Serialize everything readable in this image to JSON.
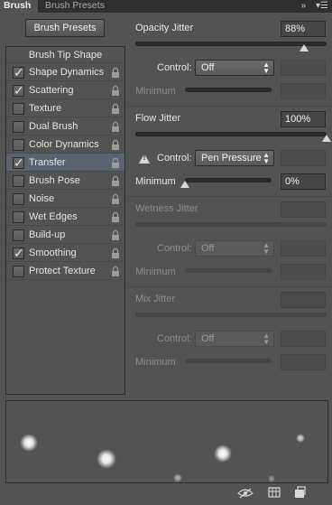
{
  "tabs": [
    {
      "label": "Brush"
    },
    {
      "label": "Brush Presets"
    }
  ],
  "tab_icons": {
    "collapse": "»",
    "menu": "▾☰"
  },
  "presets_button": "Brush Presets",
  "list": {
    "header": "Brush Tip Shape",
    "items": [
      {
        "label": "Shape Dynamics",
        "checked": true
      },
      {
        "label": "Scattering",
        "checked": true
      },
      {
        "label": "Texture",
        "checked": false
      },
      {
        "label": "Dual Brush",
        "checked": false
      },
      {
        "label": "Color Dynamics",
        "checked": false
      },
      {
        "label": "Transfer",
        "checked": true,
        "selected": true
      },
      {
        "label": "Brush Pose",
        "checked": false
      },
      {
        "label": "Noise",
        "checked": false
      },
      {
        "label": "Wet Edges",
        "checked": false
      },
      {
        "label": "Build-up",
        "checked": false
      },
      {
        "label": "Smoothing",
        "checked": true
      },
      {
        "label": "Protect Texture",
        "checked": false
      }
    ],
    "check_glyph": "✓"
  },
  "opacity": {
    "label": "Opacity Jitter",
    "value": "88%",
    "slider_fraction": 0.88,
    "control_label": "Control:",
    "control_value": "Off",
    "minimum_label": "Minimum"
  },
  "flow": {
    "label": "Flow Jitter",
    "value": "100%",
    "slider_fraction": 1.0,
    "warning": "!",
    "control_label": "Control:",
    "control_value": "Pen Pressure",
    "minimum_label": "Minimum",
    "minimum_value": "0%",
    "minimum_fraction": 0.0
  },
  "wetness": {
    "label": "Wetness Jitter",
    "control_label": "Control:",
    "control_value": "Off",
    "minimum_label": "Minimum"
  },
  "mix": {
    "label": "Mix Jitter",
    "control_label": "Control:",
    "control_value": "Off",
    "minimum_label": "Minimum"
  },
  "select_arrows": "▲\n▼",
  "bottom_icons": [
    "eye-icon",
    "grid-icon",
    "new-preset-icon"
  ]
}
